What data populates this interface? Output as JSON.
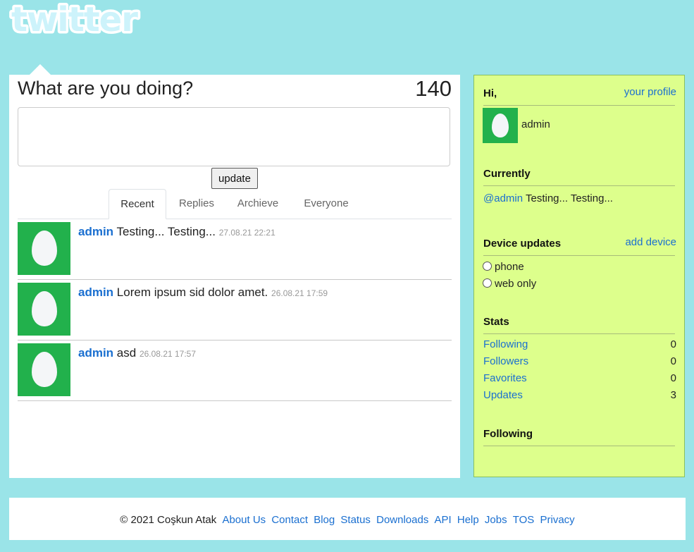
{
  "logo": {
    "text": "twitter"
  },
  "composer": {
    "question": "What are you doing?",
    "char_count": "140",
    "input_value": "",
    "update_label": "update"
  },
  "tabs": [
    "Recent",
    "Replies",
    "Archieve",
    "Everyone"
  ],
  "tweets": [
    {
      "user": "admin",
      "text": "Testing... Testing...",
      "time": "27.08.21 22:21"
    },
    {
      "user": "admin",
      "text": "Lorem ipsum sid dolor amet.",
      "time": "26.08.21 17:59"
    },
    {
      "user": "admin",
      "text": "asd",
      "time": "26.08.21 17:57"
    }
  ],
  "sidebar": {
    "greeting": "Hi,",
    "profile_link": "your profile",
    "username": "admin",
    "currently_heading": "Currently",
    "current_status_user": "@admin",
    "current_status_text": "Testing... Testing...",
    "device_heading": "Device updates",
    "add_device_link": "add device",
    "device_options": [
      "phone",
      "web only"
    ],
    "stats_heading": "Stats",
    "stats": [
      {
        "label": "Following",
        "value": "0"
      },
      {
        "label": "Followers",
        "value": "0"
      },
      {
        "label": "Favorites",
        "value": "0"
      },
      {
        "label": "Updates",
        "value": "3"
      }
    ],
    "following_heading": "Following"
  },
  "footer": {
    "copyright": "© 2021 Coşkun Atak",
    "links": [
      "About Us",
      "Contact",
      "Blog",
      "Status",
      "Downloads",
      "API",
      "Help",
      "Jobs",
      "TOS",
      "Privacy"
    ]
  },
  "colors": {
    "background": "#9ae4e8",
    "link": "#1a6fd0",
    "sidebar_bg": "#ddff8c",
    "avatar_green": "#22b14c"
  }
}
